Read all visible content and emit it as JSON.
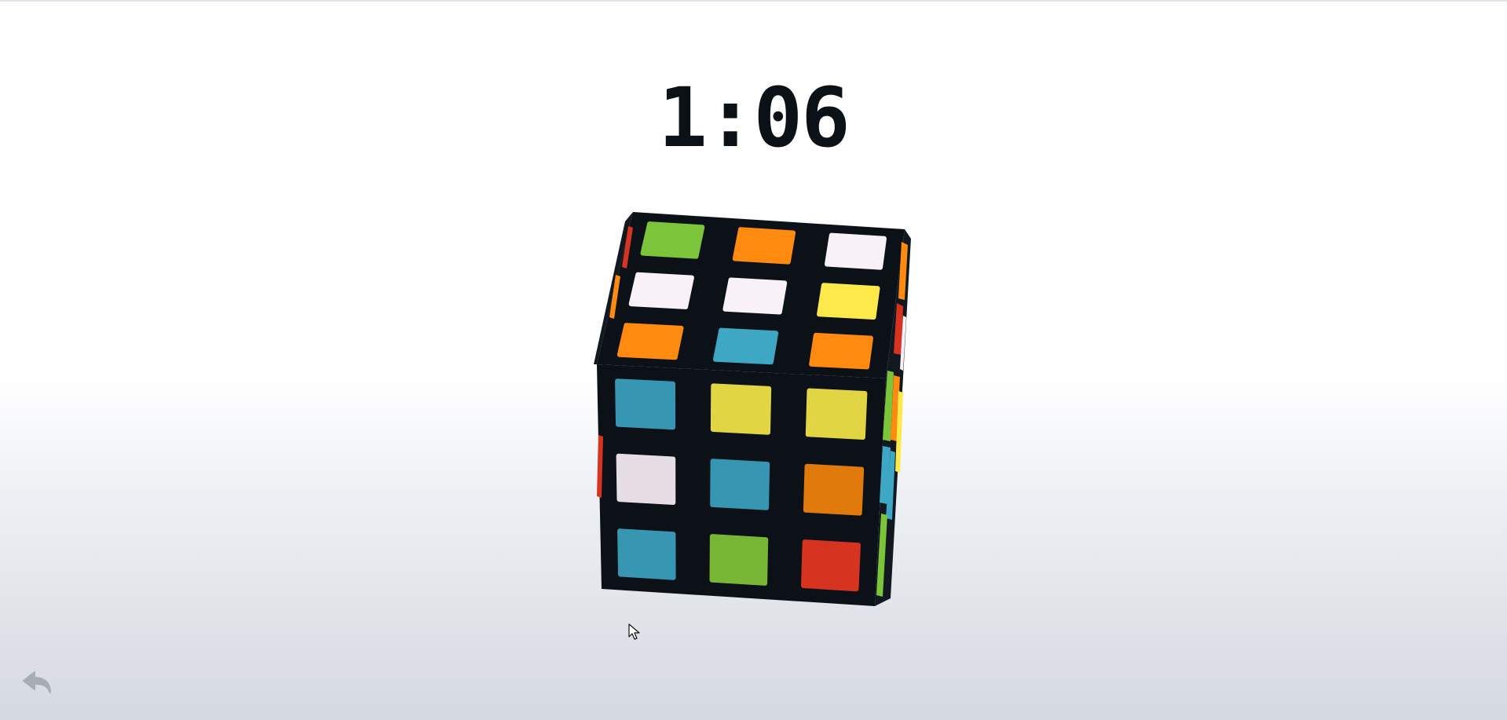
{
  "timer": {
    "value": "1:06"
  },
  "colors": {
    "green": "#7cc43a",
    "orange": "#ff8a10",
    "white": "#f8f2f8",
    "yellow": "#fde94a",
    "blue": "#3ea7c4",
    "red": "#d63321",
    "frame": "#0b1117",
    "dark_orange": "#e07a0d",
    "dim_yellow": "#e2d544",
    "dim_white": "#e6dee4",
    "dim_blue": "#3796b2",
    "dim_green": "#78b636"
  },
  "cube": {
    "top_face": [
      [
        "green",
        "orange",
        "white"
      ],
      [
        "white",
        "white",
        "yellow"
      ],
      [
        "orange",
        "blue",
        "orange"
      ]
    ],
    "front_face": [
      [
        "dim_blue",
        "dim_yellow",
        "dim_yellow"
      ],
      [
        "dim_white",
        "dim_blue",
        "dark_orange"
      ],
      [
        "dim_blue",
        "dim_green",
        "red"
      ]
    ]
  },
  "controls": {
    "undo_icon": "undo-arrow-icon"
  }
}
